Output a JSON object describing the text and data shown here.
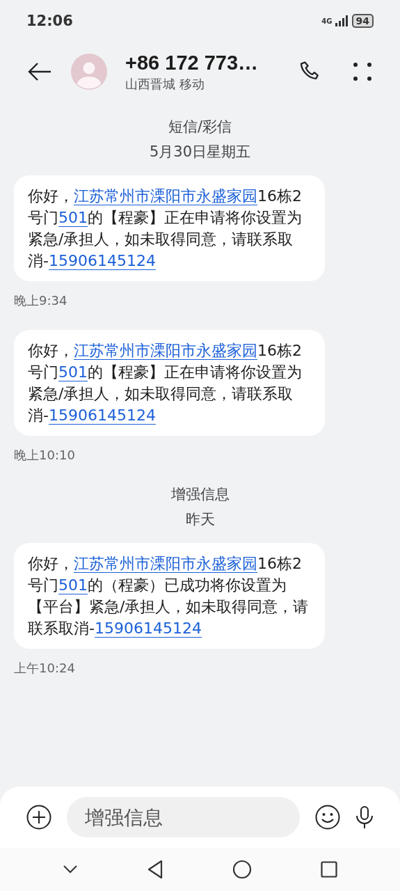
{
  "status_bar": {
    "time": "12:06",
    "network": "4G",
    "battery": "94"
  },
  "contact": {
    "name": "+86 172 773…",
    "location": "山西晋城 移动"
  },
  "thread": [
    {
      "kind": "header",
      "lines": [
        "短信/彩信",
        "5月30日星期五"
      ]
    },
    {
      "kind": "message",
      "time": "晚上9:34",
      "parts": [
        {
          "kind": "text",
          "text": "你好，"
        },
        {
          "kind": "link",
          "text": "江苏常州市溧阳市永盛家园"
        },
        {
          "kind": "text",
          "text": "16栋2号门"
        },
        {
          "kind": "link",
          "text": "501"
        },
        {
          "kind": "text",
          "text": "的【程豪】正在申请将你设置为紧急/承担人，如未取得同意，请联系取消-"
        },
        {
          "kind": "link",
          "text": "15906145124"
        }
      ]
    },
    {
      "kind": "message",
      "time": "晚上10:10",
      "parts": [
        {
          "kind": "text",
          "text": "你好，"
        },
        {
          "kind": "link",
          "text": "江苏常州市溧阳市永盛家园"
        },
        {
          "kind": "text",
          "text": "16栋2号门"
        },
        {
          "kind": "link",
          "text": "501"
        },
        {
          "kind": "text",
          "text": "的【程豪】正在申请将你设置为紧急/承担人，如未取得同意，请联系取消-"
        },
        {
          "kind": "link",
          "text": "15906145124"
        }
      ]
    },
    {
      "kind": "header",
      "lines": [
        "增强信息",
        "昨天"
      ]
    },
    {
      "kind": "message",
      "time": "上午10:24",
      "parts": [
        {
          "kind": "text",
          "text": "你好，"
        },
        {
          "kind": "link",
          "text": "江苏常州市溧阳市永盛家园"
        },
        {
          "kind": "text",
          "text": "16栋2号门"
        },
        {
          "kind": "link",
          "text": "501"
        },
        {
          "kind": "text",
          "text": "的（程豪）已成功将你设置为【平台】紧急/承担人，如未取得同意，请联系取消-"
        },
        {
          "kind": "link",
          "text": "15906145124"
        }
      ]
    }
  ],
  "composer": {
    "placeholder": "增强信息"
  }
}
